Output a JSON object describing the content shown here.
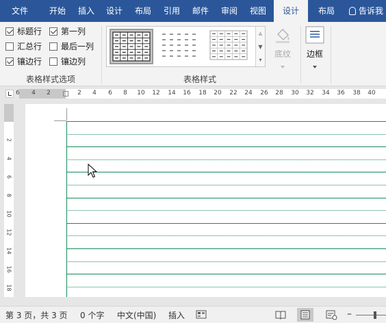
{
  "tabs": [
    {
      "label": "文件",
      "active": false
    },
    {
      "label": "开始",
      "active": false
    },
    {
      "label": "插入",
      "active": false
    },
    {
      "label": "设计",
      "active": false
    },
    {
      "label": "布局",
      "active": false
    },
    {
      "label": "引用",
      "active": false
    },
    {
      "label": "邮件",
      "active": false
    },
    {
      "label": "审阅",
      "active": false
    },
    {
      "label": "视图",
      "active": false
    },
    {
      "label": "设计",
      "active": true
    },
    {
      "label": "布局",
      "active": false
    }
  ],
  "tell_me": "告诉我",
  "table_style_options": {
    "group_label": "表格样式选项",
    "options": [
      {
        "label": "标题行",
        "checked": true
      },
      {
        "label": "第一列",
        "checked": true
      },
      {
        "label": "汇总行",
        "checked": false
      },
      {
        "label": "最后一列",
        "checked": false
      },
      {
        "label": "镶边行",
        "checked": true
      },
      {
        "label": "镶边列",
        "checked": false
      }
    ]
  },
  "table_styles": {
    "group_label": "表格样式",
    "shading_label": "底纹",
    "borders_label": "边框"
  },
  "ruler": {
    "h_ticks": [
      "6",
      "4",
      "2",
      "2",
      "4",
      "6",
      "8",
      "10",
      "12",
      "14",
      "16",
      "18",
      "20",
      "22",
      "24",
      "26",
      "28",
      "30",
      "32",
      "34",
      "36",
      "38",
      "40"
    ],
    "v_ticks": [
      "2",
      "4",
      "6",
      "8",
      "10",
      "12",
      "14",
      "16",
      "18"
    ]
  },
  "status": {
    "page": "第 3 页，共 3 页",
    "words": "0 个字",
    "language": "中文(中国)",
    "mode": "插入"
  },
  "colors": {
    "brand": "#2b579a",
    "table_border": "#1a8a5e"
  }
}
